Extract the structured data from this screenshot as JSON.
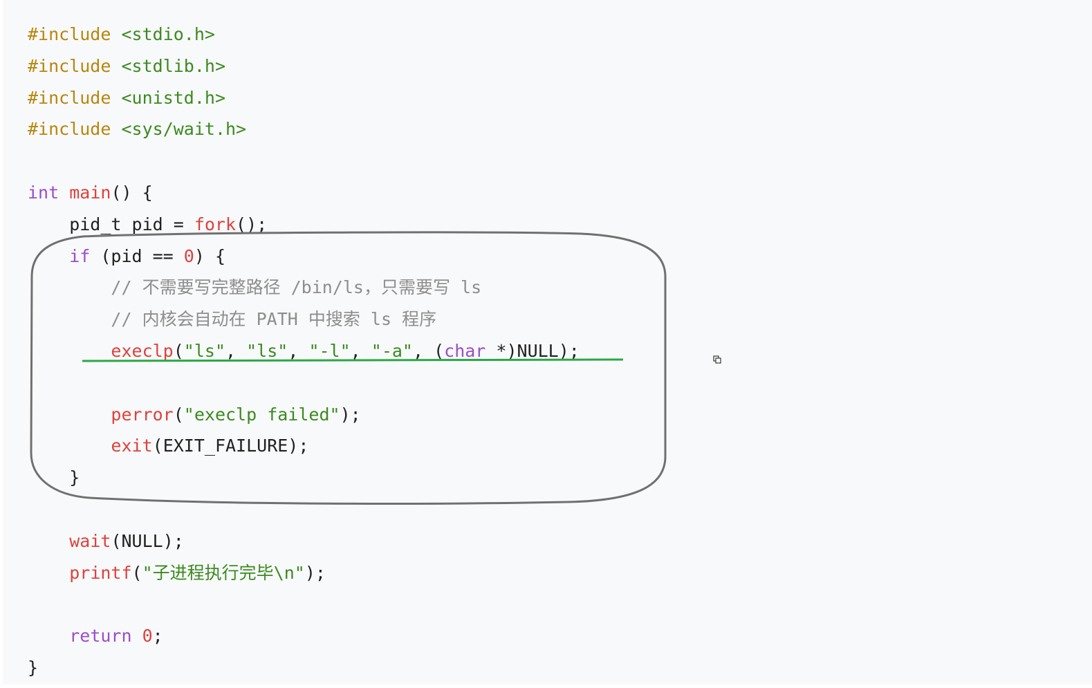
{
  "code": {
    "lines": [
      [
        {
          "t": "#include",
          "c": "pre"
        },
        {
          "t": " ",
          "c": "plain"
        },
        {
          "t": "<stdio.h>",
          "c": "hdr"
        }
      ],
      [
        {
          "t": "#include",
          "c": "pre"
        },
        {
          "t": " ",
          "c": "plain"
        },
        {
          "t": "<stdlib.h>",
          "c": "hdr"
        }
      ],
      [
        {
          "t": "#include",
          "c": "pre"
        },
        {
          "t": " ",
          "c": "plain"
        },
        {
          "t": "<unistd.h>",
          "c": "hdr"
        }
      ],
      [
        {
          "t": "#include",
          "c": "pre"
        },
        {
          "t": " ",
          "c": "plain"
        },
        {
          "t": "<sys/wait.h>",
          "c": "hdr"
        }
      ],
      [],
      [
        {
          "t": "int",
          "c": "kw"
        },
        {
          "t": " ",
          "c": "plain"
        },
        {
          "t": "main",
          "c": "fn"
        },
        {
          "t": "() {",
          "c": "plain"
        }
      ],
      [
        {
          "t": "    pid_t pid = ",
          "c": "plain"
        },
        {
          "t": "fork",
          "c": "fn"
        },
        {
          "t": "();",
          "c": "plain"
        }
      ],
      [
        {
          "t": "    ",
          "c": "plain"
        },
        {
          "t": "if",
          "c": "kw"
        },
        {
          "t": " (pid == ",
          "c": "plain"
        },
        {
          "t": "0",
          "c": "num"
        },
        {
          "t": ") {",
          "c": "plain"
        }
      ],
      [
        {
          "t": "        // 不需要写完整路径 /bin/ls，只需要写 ls",
          "c": "cmt"
        }
      ],
      [
        {
          "t": "        // 内核会自动在 PATH 中搜索 ls 程序",
          "c": "cmt"
        }
      ],
      [
        {
          "t": "        ",
          "c": "plain"
        },
        {
          "t": "execlp",
          "c": "fn"
        },
        {
          "t": "(",
          "c": "plain"
        },
        {
          "t": "\"ls\"",
          "c": "str"
        },
        {
          "t": ", ",
          "c": "plain"
        },
        {
          "t": "\"ls\"",
          "c": "str"
        },
        {
          "t": ", ",
          "c": "plain"
        },
        {
          "t": "\"-l\"",
          "c": "str"
        },
        {
          "t": ", ",
          "c": "plain"
        },
        {
          "t": "\"-a\"",
          "c": "str"
        },
        {
          "t": ", (",
          "c": "plain"
        },
        {
          "t": "char",
          "c": "kw"
        },
        {
          "t": " *)NULL);",
          "c": "plain"
        }
      ],
      [],
      [
        {
          "t": "        ",
          "c": "plain"
        },
        {
          "t": "perror",
          "c": "fn"
        },
        {
          "t": "(",
          "c": "plain"
        },
        {
          "t": "\"execlp failed\"",
          "c": "str"
        },
        {
          "t": ");",
          "c": "plain"
        }
      ],
      [
        {
          "t": "        ",
          "c": "plain"
        },
        {
          "t": "exit",
          "c": "fn"
        },
        {
          "t": "(EXIT_FAILURE);",
          "c": "plain"
        }
      ],
      [
        {
          "t": "    }",
          "c": "plain"
        }
      ],
      [],
      [
        {
          "t": "    ",
          "c": "plain"
        },
        {
          "t": "wait",
          "c": "fn"
        },
        {
          "t": "(NULL);",
          "c": "plain"
        }
      ],
      [
        {
          "t": "    ",
          "c": "plain"
        },
        {
          "t": "printf",
          "c": "fn"
        },
        {
          "t": "(",
          "c": "plain"
        },
        {
          "t": "\"子进程执行完毕\\n\"",
          "c": "str"
        },
        {
          "t": ");",
          "c": "plain"
        }
      ],
      [],
      [
        {
          "t": "    ",
          "c": "plain"
        },
        {
          "t": "return",
          "c": "kw"
        },
        {
          "t": " ",
          "c": "plain"
        },
        {
          "t": "0",
          "c": "num"
        },
        {
          "t": ";",
          "c": "plain"
        }
      ],
      [
        {
          "t": "}",
          "c": "plain"
        }
      ]
    ]
  },
  "annotations": {
    "circle_color": "#707070",
    "underline_color": "#2aa845"
  },
  "icons": {
    "copy": "copy-icon"
  }
}
